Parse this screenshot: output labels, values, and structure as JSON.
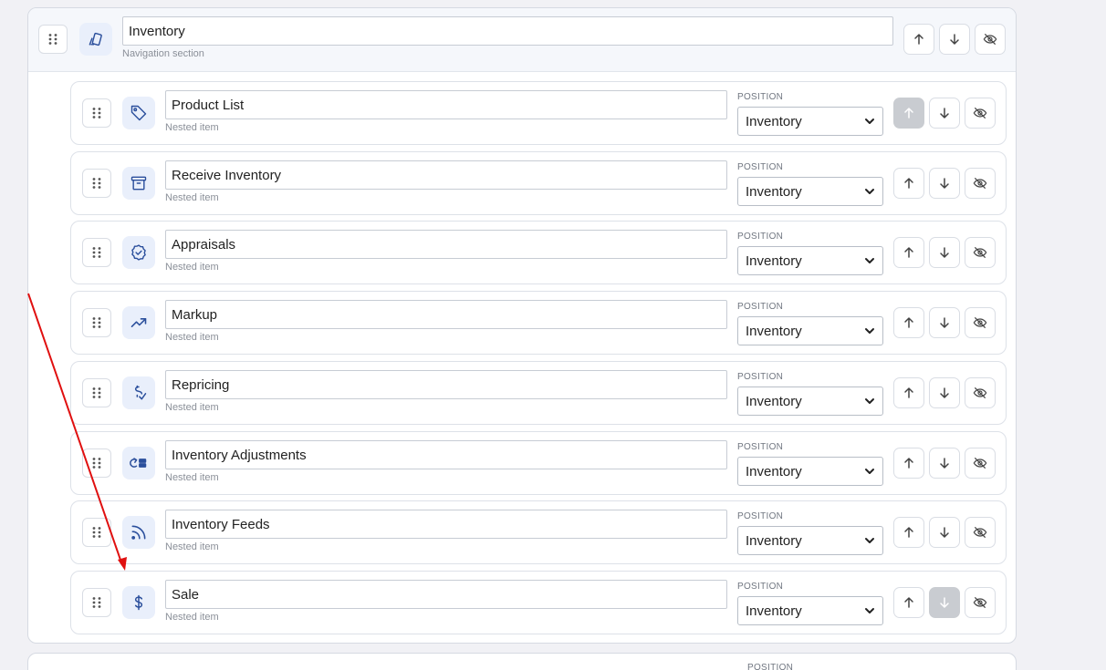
{
  "section": {
    "title": "Inventory",
    "subtitle": "Navigation section"
  },
  "position_label": "POSITION",
  "items": [
    {
      "label": "Product List",
      "sub": "Nested item",
      "position": "Inventory",
      "icon": "tag-icon",
      "up_disabled": true,
      "down_disabled": false
    },
    {
      "label": "Receive Inventory",
      "sub": "Nested item",
      "position": "Inventory",
      "icon": "archive-box-icon",
      "up_disabled": false,
      "down_disabled": false
    },
    {
      "label": "Appraisals",
      "sub": "Nested item",
      "position": "Inventory",
      "icon": "badge-check-icon",
      "up_disabled": false,
      "down_disabled": false
    },
    {
      "label": "Markup",
      "sub": "Nested item",
      "position": "Inventory",
      "icon": "trending-up-icon",
      "up_disabled": false,
      "down_disabled": false
    },
    {
      "label": "Repricing",
      "sub": "Nested item",
      "position": "Inventory",
      "icon": "dollar-check-icon",
      "up_disabled": false,
      "down_disabled": false
    },
    {
      "label": "Inventory Adjustments",
      "sub": "Nested item",
      "position": "Inventory",
      "icon": "adjustments-icon",
      "up_disabled": false,
      "down_disabled": false
    },
    {
      "label": "Inventory Feeds",
      "sub": "Nested item",
      "position": "Inventory",
      "icon": "rss-icon",
      "up_disabled": false,
      "down_disabled": false
    },
    {
      "label": "Sale",
      "sub": "Nested item",
      "position": "Inventory",
      "icon": "dollar-icon",
      "up_disabled": false,
      "down_disabled": true
    }
  ],
  "next_section": {
    "position_label": "POSITION"
  },
  "colors": {
    "accent": "#2b4f9c",
    "icon_bg": "#e9effb",
    "annotation_arrow": "#e01010",
    "disabled_button": "#c9ccd1"
  }
}
